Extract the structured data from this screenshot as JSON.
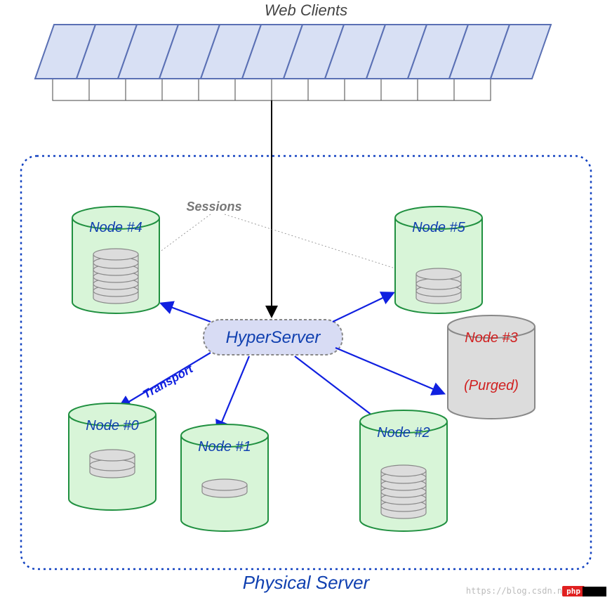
{
  "title": "Web Clients",
  "container_label": "Physical Server",
  "hub_label": "HyperServer",
  "sessions_label": "Sessions",
  "transport_label": "Transport",
  "nodes": {
    "n0": "Node #0",
    "n1": "Node #1",
    "n2": "Node #2",
    "n3": "Node #3",
    "n3_status": "(Purged)",
    "n4": "Node #4",
    "n5": "Node #5"
  },
  "watermark_text": "https://blog.csdn.n",
  "watermark_badge": "php",
  "num_web_clients": 12,
  "colors": {
    "client_fill": "#d8e0f4",
    "client_stroke": "#5a70b4",
    "container_stroke": "#1040c0",
    "node_fill": "#d8f5d8",
    "node_stroke": "#209040",
    "purged_fill": "#dcdcdc",
    "purged_stroke": "#888",
    "hub_fill": "#d8dcf4",
    "hub_stroke": "#888",
    "arrow_blue": "#1020e0",
    "arrow_black": "#000",
    "disk_fill": "#dcdcdc",
    "disk_stroke": "#888"
  }
}
